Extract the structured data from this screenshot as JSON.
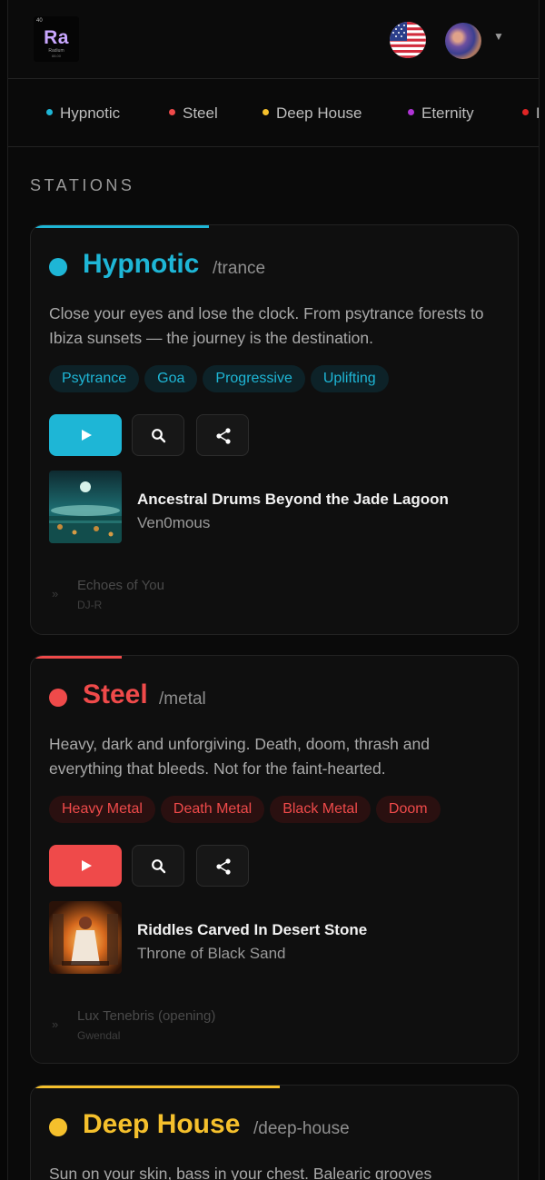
{
  "header": {
    "logo": {
      "number": "40",
      "symbol": "Ra",
      "name": "Radium",
      "mass": "88.00"
    },
    "language_flag": "us-flag-icon",
    "avatar": "user-avatar"
  },
  "tabs": [
    {
      "label": "Hypnotic",
      "color": "#1eb6d6"
    },
    {
      "label": "Steel",
      "color": "#ef4a4a"
    },
    {
      "label": "Deep House",
      "color": "#f5c02c"
    },
    {
      "label": "Eternity",
      "color": "#b034d6"
    },
    {
      "label": "D",
      "color": "#e02525"
    }
  ],
  "section_title": "STATIONS",
  "stations": [
    {
      "name": "Hypnotic",
      "slug": "/trance",
      "accent": "#1eb6d6",
      "description": "Close your eyes and lose the clock. From psytrance forests to Ibiza sunsets — the journey is the destination.",
      "tags": [
        "Psytrance",
        "Goa",
        "Progressive",
        "Uplifting"
      ],
      "now_playing": {
        "title": "Ancestral Drums Beyond the Jade Lagoon",
        "artist": "Ven0mous"
      },
      "previous": {
        "title": "Echoes of You",
        "artist": "DJ-R"
      }
    },
    {
      "name": "Steel",
      "slug": "/metal",
      "accent": "#ef4a4a",
      "description": "Heavy, dark and unforgiving. Death, doom, thrash and everything that bleeds. Not for the faint-hearted.",
      "tags": [
        "Heavy Metal",
        "Death Metal",
        "Black Metal",
        "Doom"
      ],
      "now_playing": {
        "title": "Riddles Carved In Desert Stone",
        "artist": "Throne of Black Sand"
      },
      "previous": {
        "title": "Lux Tenebris (opening)",
        "artist": "Gwendal"
      }
    },
    {
      "name": "Deep House",
      "slug": "/deep-house",
      "accent": "#f5c02c",
      "description": "Sun on your skin, bass in your chest. Balearic grooves"
    }
  ]
}
